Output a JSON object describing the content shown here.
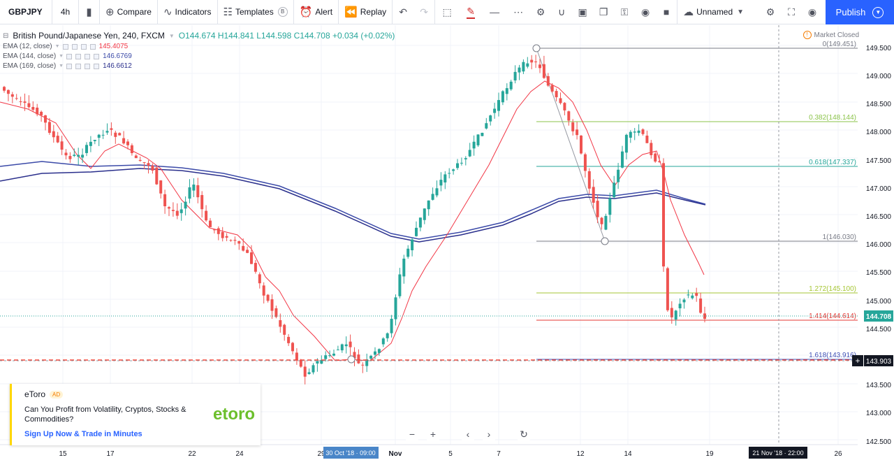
{
  "toolbar": {
    "symbol": "GBPJPY",
    "interval": "4h",
    "compare_label": "Compare",
    "indicators_label": "Indicators",
    "templates_label": "Templates",
    "alert_label": "Alert",
    "replay_label": "Replay",
    "layout_name": "Unnamed",
    "publish_label": "Publish"
  },
  "legend": {
    "title": "British Pound/Japanese Yen, 240, FXCM",
    "ohlc": "O144.674  H144.841  L144.598  C144.708  +0.034 (+0.02%)",
    "indicators": [
      {
        "label": "EMA (12, close)",
        "value": "145.4075",
        "color": "#f23645"
      },
      {
        "label": "EMA (144, close)",
        "value": "146.6769",
        "color": "#3b4aa8"
      },
      {
        "label": "EMA (169, close)",
        "value": "146.6612",
        "color": "#2a2f8c"
      }
    ]
  },
  "market_status": "Market Closed",
  "price_axis": {
    "labels": [
      "149.500",
      "149.000",
      "148.500",
      "148.000",
      "147.500",
      "147.000",
      "146.500",
      "146.000",
      "145.500",
      "145.000",
      "144.500",
      "143.500",
      "143.000",
      "142.500"
    ],
    "current_price": "144.708",
    "crosshair_price": "143.903"
  },
  "time_axis": {
    "labels": [
      "15",
      "17",
      "22",
      "24",
      "29",
      "Nov",
      "5",
      "7",
      "12",
      "14",
      "19",
      "26"
    ],
    "hover_time": "30 Oct '18 · 09:00",
    "crosshair_time": "21 Nov '18 · 22:00"
  },
  "fibonacci": [
    {
      "label": "0(149.451)",
      "color": "#787b86"
    },
    {
      "label": "0.382(148.144)",
      "color": "#8bc34a"
    },
    {
      "label": "0.618(147.337)",
      "color": "#26a69a"
    },
    {
      "label": "1(146.030)",
      "color": "#787b86"
    },
    {
      "label": "1.272(145.100)",
      "color": "#a5c634"
    },
    {
      "label": "1.414(144.614)",
      "color": "#e53935"
    },
    {
      "label": "1.618(143.916)",
      "color": "#3f51b5"
    }
  ],
  "ad": {
    "brand": "eToro",
    "badge": "AD",
    "body": "Can You Profit from Volatility, Cryptos, Stocks & Commodities?",
    "cta": "Sign Up Now & Trade in Minutes",
    "logo_text": "etoro"
  },
  "colors": {
    "up": "#26a69a",
    "down": "#ef5350",
    "ema12": "#f23645",
    "ema144": "#3b4aa8",
    "ema169": "#2a2f8c",
    "accent": "#2962ff"
  }
}
